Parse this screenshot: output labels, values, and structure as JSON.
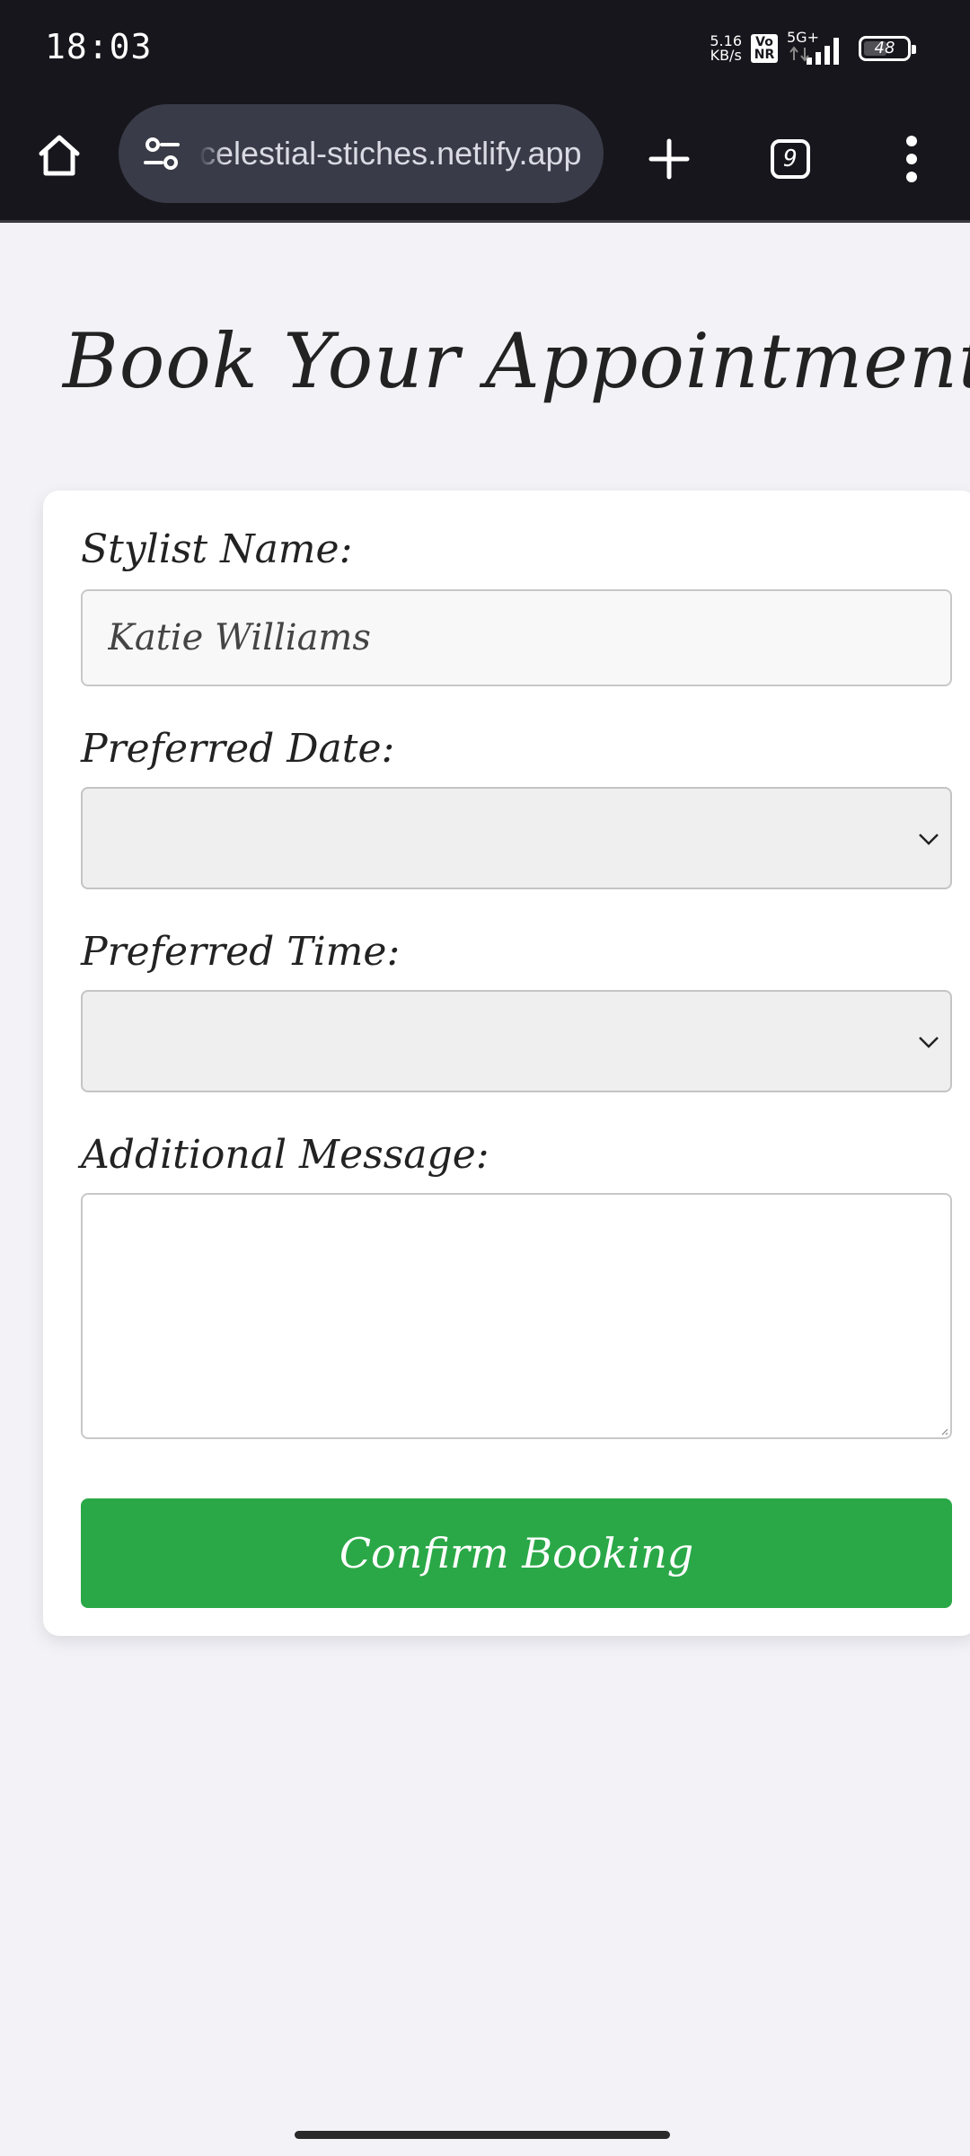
{
  "status_bar": {
    "time": "18:03",
    "net_speed_value": "5.16",
    "net_speed_unit": "KB/s",
    "volte_label": "Vo NR",
    "network_type": "5G+",
    "battery_level": "48"
  },
  "browser": {
    "url": "celestial-stiches.netlify.app",
    "tab_count": "9",
    "icons": {
      "home": "home-icon",
      "site_settings": "tune-icon",
      "new_tab": "plus-icon",
      "menu": "more-vert-icon"
    }
  },
  "page": {
    "title": "Book Your Appointment",
    "form": {
      "stylist_label": "Stylist Name:",
      "stylist_value": "Katie Williams",
      "date_label": "Preferred Date:",
      "date_value": "",
      "time_label": "Preferred Time:",
      "time_value": "",
      "message_label": "Additional Message:",
      "message_value": "",
      "confirm_label": "Confirm Booking"
    }
  },
  "colors": {
    "page_background": "#f2f2f7",
    "system_bar": "#16161c",
    "url_pill": "#3a3b48",
    "confirm_button": "#2aa847",
    "card": "#ffffff"
  }
}
